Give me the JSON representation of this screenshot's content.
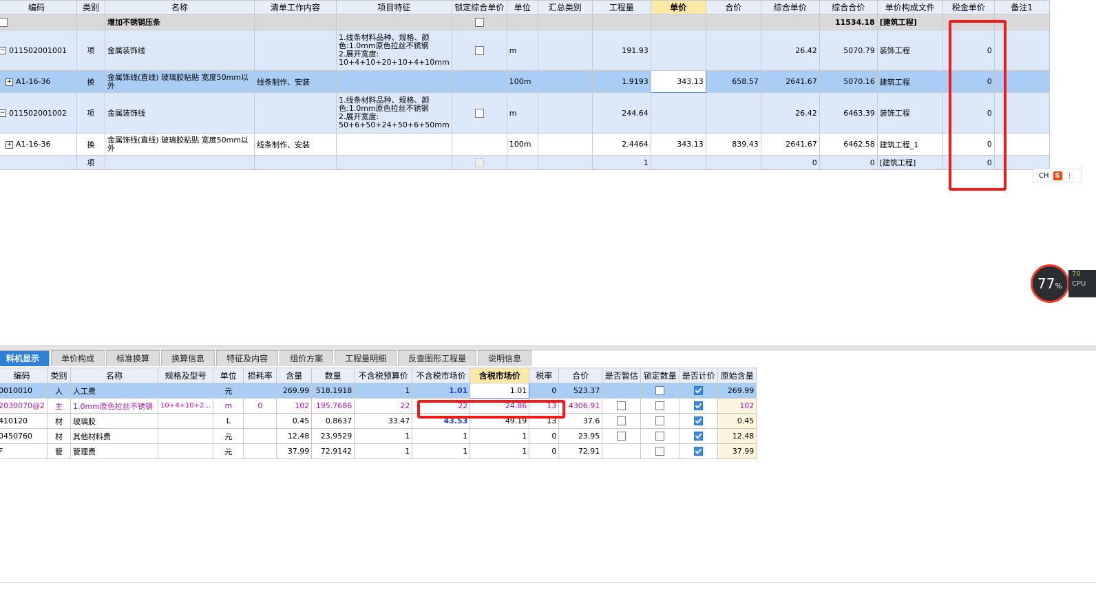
{
  "top_grid": {
    "headers": [
      "编码",
      "类别",
      "名称",
      "清单工作内容",
      "项目特征",
      "锁定综合单价",
      "单位",
      "汇总类别",
      "工程量",
      "单价",
      "合价",
      "综合单价",
      "综合合价",
      "单价构成文件",
      "税金单价",
      "备注1"
    ],
    "rows": [
      {
        "name": "增加不锈钢压条",
        "total": "11534.18",
        "file": "[建筑工程]"
      },
      {
        "code": "011502001001",
        "type": "项",
        "name": "金属装饰线",
        "features": "1.线条材料品种、规格、颜色:1.0mm原色拉丝不锈钢\n2.展开宽度:\n10+4+10+20+10+4+10mm",
        "unit": "m",
        "qty": "191.93",
        "unit_price": "",
        "amount": "",
        "comp_price": "26.42",
        "comp_total": "5070.79",
        "file": "装饰工程",
        "tax": "0"
      },
      {
        "code": "A1-16-36",
        "type": "换",
        "name": "金属饰线(直线) 玻璃胶粘贴 宽度50mm以外",
        "work": "线条制作、安装",
        "unit": "100m",
        "qty": "1.9193",
        "unit_price": "343.13",
        "amount": "658.57",
        "comp_price": "2641.67",
        "comp_total": "5070.16",
        "file": "建筑工程",
        "tax": "0"
      },
      {
        "code": "011502001002",
        "type": "项",
        "name": "金属装饰线",
        "features": "1.线条材料品种、规格、颜色:1.0mm原色拉丝不锈钢\n2.展开宽度:\n50+6+50+24+50+6+50mm",
        "unit": "m",
        "qty": "244.64",
        "comp_price": "26.42",
        "comp_total": "6463.39",
        "file": "装饰工程",
        "tax": "0"
      },
      {
        "code": "A1-16-36",
        "type": "换",
        "name": "金属饰线(直线) 玻璃胶粘贴 宽度50mm以外",
        "work": "线条制作、安装",
        "unit": "100m",
        "qty": "2.4464",
        "unit_price": "343.13",
        "amount": "839.43",
        "comp_price": "2641.67",
        "comp_total": "6462.58",
        "file": "建筑工程_1",
        "tax": "0"
      },
      {
        "type": "项",
        "qty": "1",
        "comp_price": "0",
        "comp_total": "0",
        "file": "[建筑工程]",
        "tax": "0"
      }
    ]
  },
  "ime": {
    "label": "CH",
    "logo": "S"
  },
  "cpu": {
    "value": "77",
    "unit": "%",
    "side_value": "70",
    "side_label": "CPU"
  },
  "tabs": [
    "料机显示",
    "单价构成",
    "标准换算",
    "换算信息",
    "特征及内容",
    "组价方案",
    "工程量明细",
    "反查图形工程量",
    "说明信息"
  ],
  "bottom_grid": {
    "headers": [
      "编码",
      "类别",
      "名称",
      "规格及型号",
      "单位",
      "损耗率",
      "含量",
      "数量",
      "不含税预算价",
      "不含税市场价",
      "含税市场价",
      "税率",
      "合价",
      "是否暂估",
      "锁定数量",
      "是否计价",
      "原始含量"
    ],
    "rows": [
      {
        "code": "0010010",
        "type": "人",
        "name": "人工费",
        "spec": "",
        "unit": "元",
        "loss": "",
        "content": "269.99",
        "qty": "518.1918",
        "budget": "1",
        "market": "1.01",
        "market_tax": "1.01",
        "rate": "0",
        "total": "523.37",
        "orig": "269.99"
      },
      {
        "code": "2030070@2",
        "type": "主",
        "name": "1.0mm原色拉丝不锈钢",
        "spec": "10+4+10+2…",
        "unit": "m",
        "loss": "0",
        "content": "102",
        "qty": "195.7686",
        "budget": "22",
        "market": "22",
        "market_tax": "24.86",
        "rate": "13",
        "total": "4306.91",
        "orig": "102"
      },
      {
        "code": "410120",
        "type": "材",
        "name": "玻璃胶",
        "spec": "",
        "unit": "L",
        "loss": "",
        "content": "0.45",
        "qty": "0.8637",
        "budget": "33.47",
        "market": "43.53",
        "market_tax": "49.19",
        "rate": "13",
        "total": "37.6",
        "orig": "0.45"
      },
      {
        "code": "0450760",
        "type": "材",
        "name": "其他材料费",
        "spec": "",
        "unit": "元",
        "loss": "",
        "content": "12.48",
        "qty": "23.9529",
        "budget": "1",
        "market": "1",
        "market_tax": "1",
        "rate": "0",
        "total": "23.95",
        "orig": "12.48"
      },
      {
        "code": "F",
        "type": "管",
        "name": "管理费",
        "spec": "",
        "unit": "元",
        "loss": "",
        "content": "37.99",
        "qty": "72.9142",
        "budget": "1",
        "market": "1",
        "market_tax": "1",
        "rate": "0",
        "total": "72.91",
        "orig": "37.99"
      }
    ]
  },
  "colors": {
    "accent": "#2f7fd5",
    "highlight": "#ef1b1b",
    "selected_row": "#a9cdf5",
    "header": "#e7eef8",
    "active_header": "#fbe9a6"
  }
}
